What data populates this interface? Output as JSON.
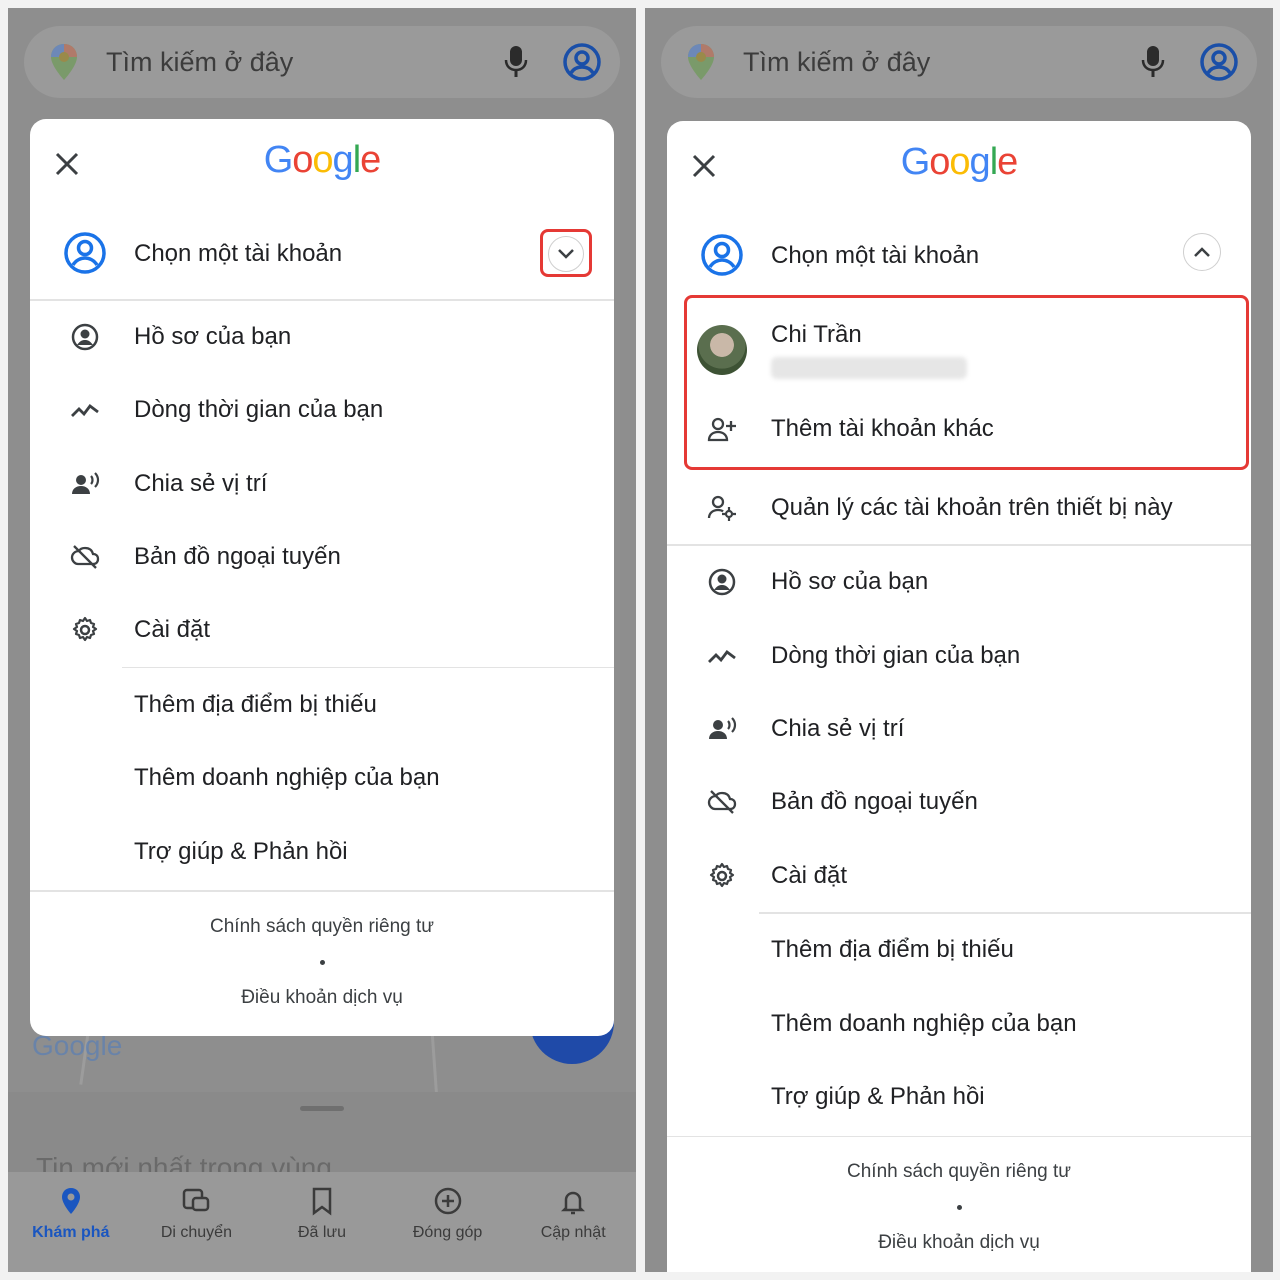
{
  "search": {
    "placeholder": "Tìm kiếm ở đây"
  },
  "brand": {
    "logo": "Google",
    "map_logo": "Google"
  },
  "account_header": {
    "label": "Chọn một tài khoản"
  },
  "account": {
    "name": "Chi Trần",
    "add_account": "Thêm tài khoản khác",
    "manage_accounts": "Quản lý các tài khoản trên thiết bị này"
  },
  "menu": {
    "profile": "Hồ sơ của bạn",
    "timeline": "Dòng thời gian của bạn",
    "location_sharing": "Chia sẻ vị trí",
    "offline_maps": "Bản đồ ngoại tuyến",
    "settings": "Cài đặt",
    "add_missing_place": "Thêm địa điểm bị thiếu",
    "add_business": "Thêm doanh nghiệp của bạn",
    "help_feedback": "Trợ giúp & Phản hồi"
  },
  "footer": {
    "privacy": "Chính sách quyền riêng tư",
    "terms": "Điều khoản dịch vụ"
  },
  "bottom_sheet": {
    "ghost_title": "Tin mới nhất trong vùng"
  },
  "nav": {
    "explore": "Khám phá",
    "go": "Di chuyển",
    "saved": "Đã lưu",
    "contribute": "Đóng góp",
    "updates": "Cập nhật"
  },
  "colors": {
    "accent_blue": "#1a73e8",
    "highlight_red": "#e53935",
    "google_blue": "#4285f4",
    "google_red": "#ea4335",
    "google_yellow": "#fbbc05",
    "google_green": "#34a853"
  }
}
